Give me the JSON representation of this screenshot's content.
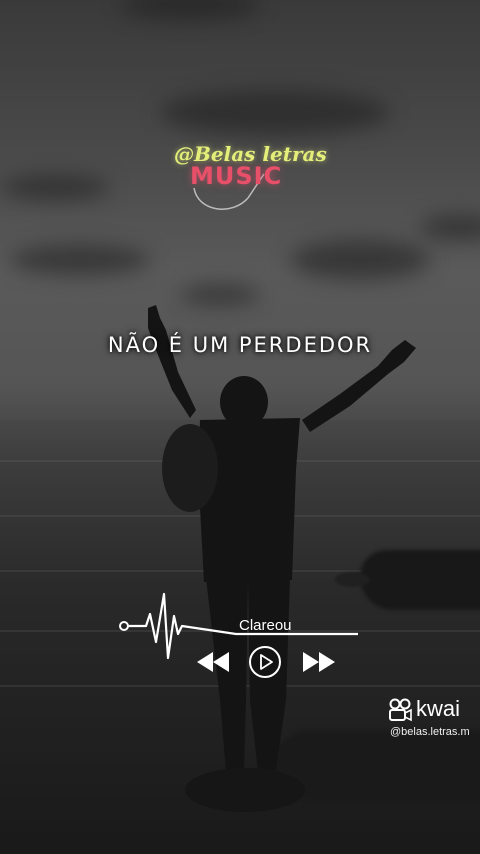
{
  "watermark": {
    "handle": "@Belas letras",
    "subtitle": "MUSIC",
    "handle_color": "#e4ef7a",
    "subtitle_color": "#e8506a"
  },
  "lyric": {
    "line": "NÃO É UM PERDEDOR"
  },
  "player": {
    "song_title": "Clareou",
    "controls": [
      "rewind-icon",
      "play-icon",
      "fast-forward-icon"
    ]
  },
  "branding": {
    "app_name": "kwai",
    "username": "@belas.letras.m",
    "icon": "kwai-logo-icon"
  }
}
